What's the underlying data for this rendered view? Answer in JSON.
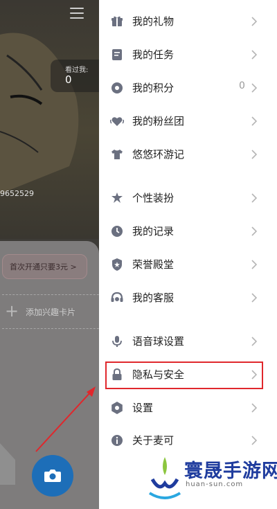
{
  "background": {
    "visited_label": "看过我:",
    "visited_count": "0",
    "user_id": "9652529",
    "vip_promo": "首次开通只要3元 >",
    "add_card_label": "添加兴趣卡片"
  },
  "menu": {
    "items": [
      {
        "label": "我的礼物",
        "icon": "gift-icon"
      },
      {
        "label": "我的任务",
        "icon": "task-icon"
      },
      {
        "label": "我的积分",
        "icon": "points-icon",
        "value": "0"
      },
      {
        "label": "我的粉丝团",
        "icon": "fan-club-icon"
      },
      {
        "label": "悠悠环游记",
        "icon": "shirt-icon"
      },
      {
        "label": "个性装扮",
        "icon": "dress-up-icon"
      },
      {
        "label": "我的记录",
        "icon": "clock-icon"
      },
      {
        "label": "荣誉殿堂",
        "icon": "shield-icon"
      },
      {
        "label": "我的客服",
        "icon": "headset-icon"
      },
      {
        "label": "语音球设置",
        "icon": "microphone-icon"
      },
      {
        "label": "隐私与安全",
        "icon": "lock-icon"
      },
      {
        "label": "设置",
        "icon": "settings-icon"
      },
      {
        "label": "关于麦可",
        "icon": "info-icon"
      }
    ]
  },
  "annotation": {
    "highlight_color": "#e0272c"
  },
  "watermark": {
    "title": "寰晟手游网",
    "subtitle": "huan-sun.com"
  },
  "colors": {
    "icon": "#6b7080",
    "chevron": "#b5b5b5",
    "accent_blue": "#1d6eb8"
  }
}
